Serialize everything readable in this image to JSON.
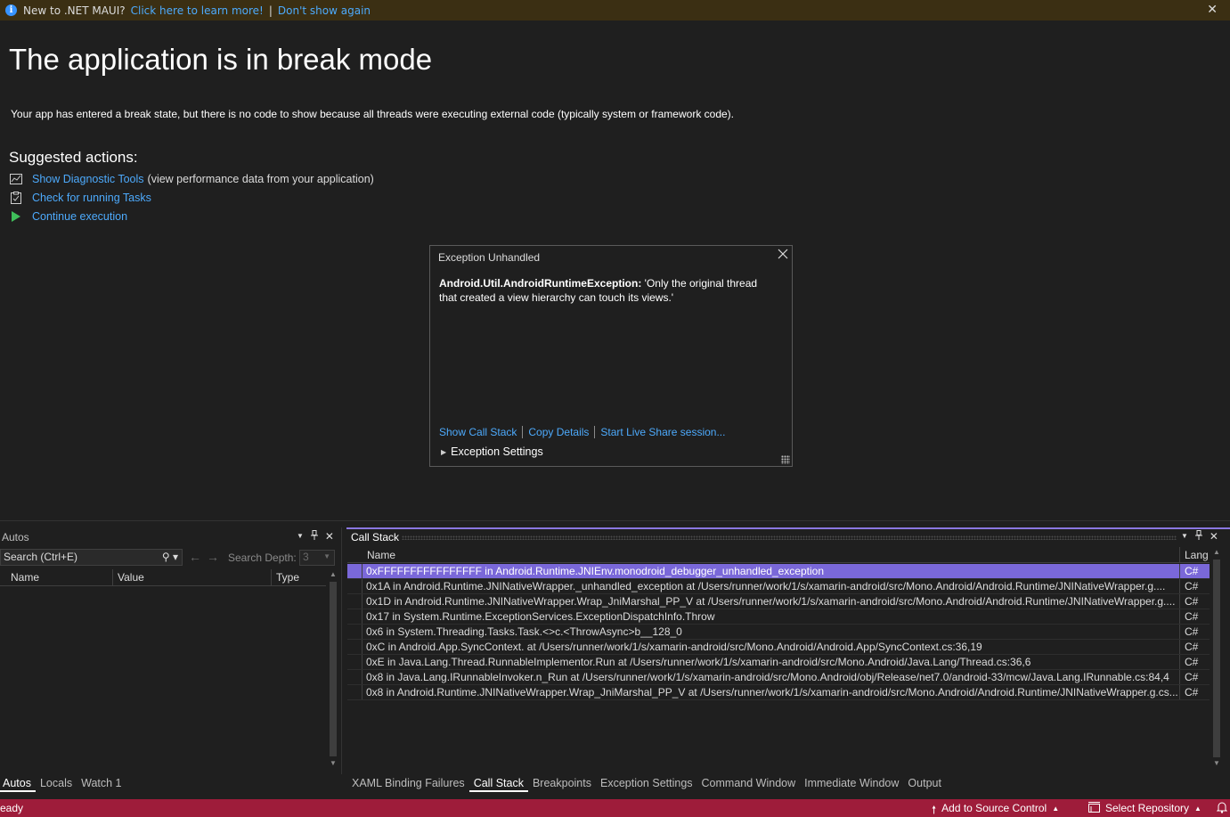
{
  "infobar": {
    "question": "New to .NET MAUI?",
    "learn_link": "Click here to learn more!",
    "separator": "|",
    "dismiss_link": "Don't show again",
    "close": "✕"
  },
  "break_mode": {
    "title": "The application is in break mode",
    "description": "Your app has entered a break state, but there is no code to show because all threads were executing external code (typically system or framework code).",
    "suggested_heading": "Suggested actions:",
    "actions": [
      {
        "label": "Show Diagnostic Tools",
        "extra": "(view performance data from your application)",
        "icon": "diagnostic-chart-icon"
      },
      {
        "label": "Check for running Tasks",
        "extra": "",
        "icon": "tasks-clipboard-icon"
      },
      {
        "label": "Continue execution",
        "extra": "",
        "icon": "play-icon"
      }
    ]
  },
  "exception": {
    "heading": "Exception Unhandled",
    "type": "Android.Util.AndroidRuntimeException:",
    "message": "'Only the original thread that created a view hierarchy can touch its views.'",
    "links": [
      "Show Call Stack",
      "Copy Details",
      "Start Live Share session..."
    ],
    "settings_label": "Exception Settings"
  },
  "autos": {
    "title": "Autos",
    "search_placeholder": "Search (Ctrl+E)",
    "search_depth_label": "Search Depth:",
    "search_depth_value": "3",
    "columns": [
      "Name",
      "Value",
      "Type"
    ]
  },
  "callstack": {
    "title": "Call Stack",
    "columns": [
      "Name",
      "Lang"
    ],
    "rows": [
      {
        "name": "0xFFFFFFFFFFFFFFFF in Android.Runtime.JNIEnv.monodroid_debugger_unhandled_exception",
        "lang": "C#"
      },
      {
        "name": "0x1A in Android.Runtime.JNINativeWrapper._unhandled_exception at /Users/runner/work/1/s/xamarin-android/src/Mono.Android/Android.Runtime/JNINativeWrapper.g....",
        "lang": "C#"
      },
      {
        "name": "0x1D in Android.Runtime.JNINativeWrapper.Wrap_JniMarshal_PP_V at /Users/runner/work/1/s/xamarin-android/src/Mono.Android/Android.Runtime/JNINativeWrapper.g....",
        "lang": "C#"
      },
      {
        "name": "0x17 in System.Runtime.ExceptionServices.ExceptionDispatchInfo.Throw",
        "lang": "C#"
      },
      {
        "name": "0x6 in System.Threading.Tasks.Task.<>c.<ThrowAsync>b__128_0",
        "lang": "C#"
      },
      {
        "name": "0xC in Android.App.SyncContext. at /Users/runner/work/1/s/xamarin-android/src/Mono.Android/Android.App/SyncContext.cs:36,19",
        "lang": "C#"
      },
      {
        "name": "0xE in Java.Lang.Thread.RunnableImplementor.Run at /Users/runner/work/1/s/xamarin-android/src/Mono.Android/Java.Lang/Thread.cs:36,6",
        "lang": "C#"
      },
      {
        "name": "0x8 in Java.Lang.IRunnableInvoker.n_Run at /Users/runner/work/1/s/xamarin-android/src/Mono.Android/obj/Release/net7.0/android-33/mcw/Java.Lang.IRunnable.cs:84,4",
        "lang": "C#"
      },
      {
        "name": "0x8 in Android.Runtime.JNINativeWrapper.Wrap_JniMarshal_PP_V at /Users/runner/work/1/s/xamarin-android/src/Mono.Android/Android.Runtime/JNINativeWrapper.g.cs...",
        "lang": "C#"
      }
    ]
  },
  "tabs_left": [
    "Autos",
    "Locals",
    "Watch 1"
  ],
  "tabs_right": [
    "XAML Binding Failures",
    "Call Stack",
    "Breakpoints",
    "Exception Settings",
    "Command Window",
    "Immediate Window",
    "Output"
  ],
  "status": {
    "ready": "eady",
    "source_control": "Add to Source Control",
    "repository": "Select Repository"
  },
  "colors": {
    "accent": "#7a68d9",
    "status_bar": "#9e1c3a",
    "link": "#4daafc",
    "infobar": "#3b2f13"
  }
}
